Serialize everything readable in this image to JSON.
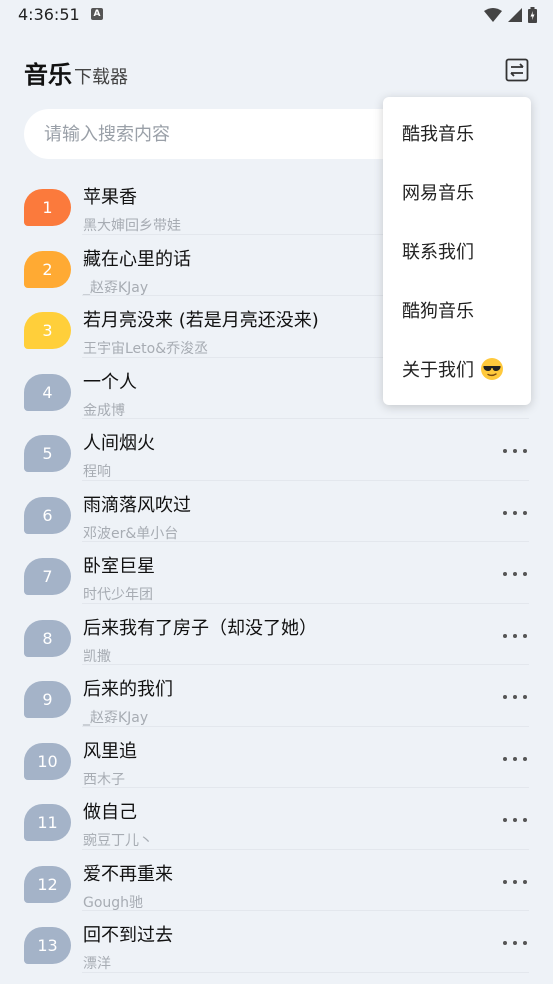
{
  "status_bar": {
    "time": "4:36:51",
    "notification_icon": "A"
  },
  "header": {
    "title": "音乐",
    "subtitle": "下载器"
  },
  "search": {
    "placeholder": "请输入搜索内容"
  },
  "colors": {
    "rank1": "#fb7a3c",
    "rank2": "#ffaa33",
    "rank3": "#ffcf3a",
    "rank_default": "#a4b3c8"
  },
  "songs": [
    {
      "rank": "1",
      "title": "苹果香",
      "artist": "黑大婶回乡带娃"
    },
    {
      "rank": "2",
      "title": "藏在心里的话",
      "artist": "_赵孬KJay"
    },
    {
      "rank": "3",
      "title": "若月亮没来 (若是月亮还没来)",
      "artist": "王宇宙Leto&乔浚丞"
    },
    {
      "rank": "4",
      "title": "一个人",
      "artist": "金成博"
    },
    {
      "rank": "5",
      "title": "人间烟火",
      "artist": "程响"
    },
    {
      "rank": "6",
      "title": "雨滴落风吹过",
      "artist": "邓波er&单小台"
    },
    {
      "rank": "7",
      "title": "卧室巨星",
      "artist": "时代少年团"
    },
    {
      "rank": "8",
      "title": "后来我有了房子（却没了她）",
      "artist": "凯撒"
    },
    {
      "rank": "9",
      "title": "后来的我们",
      "artist": "_赵孬KJay"
    },
    {
      "rank": "10",
      "title": "风里追",
      "artist": "西木子"
    },
    {
      "rank": "11",
      "title": "做自己",
      "artist": "豌豆丁儿丶"
    },
    {
      "rank": "12",
      "title": "爱不再重来",
      "artist": "Gough驰"
    },
    {
      "rank": "13",
      "title": "回不到过去",
      "artist": "漂洋"
    }
  ],
  "menu": {
    "items": [
      "酷我音乐",
      "网易音乐",
      "联系我们",
      "酷狗音乐",
      "关于我们"
    ],
    "last_item_icon": "sunglasses-emoji-icon"
  }
}
